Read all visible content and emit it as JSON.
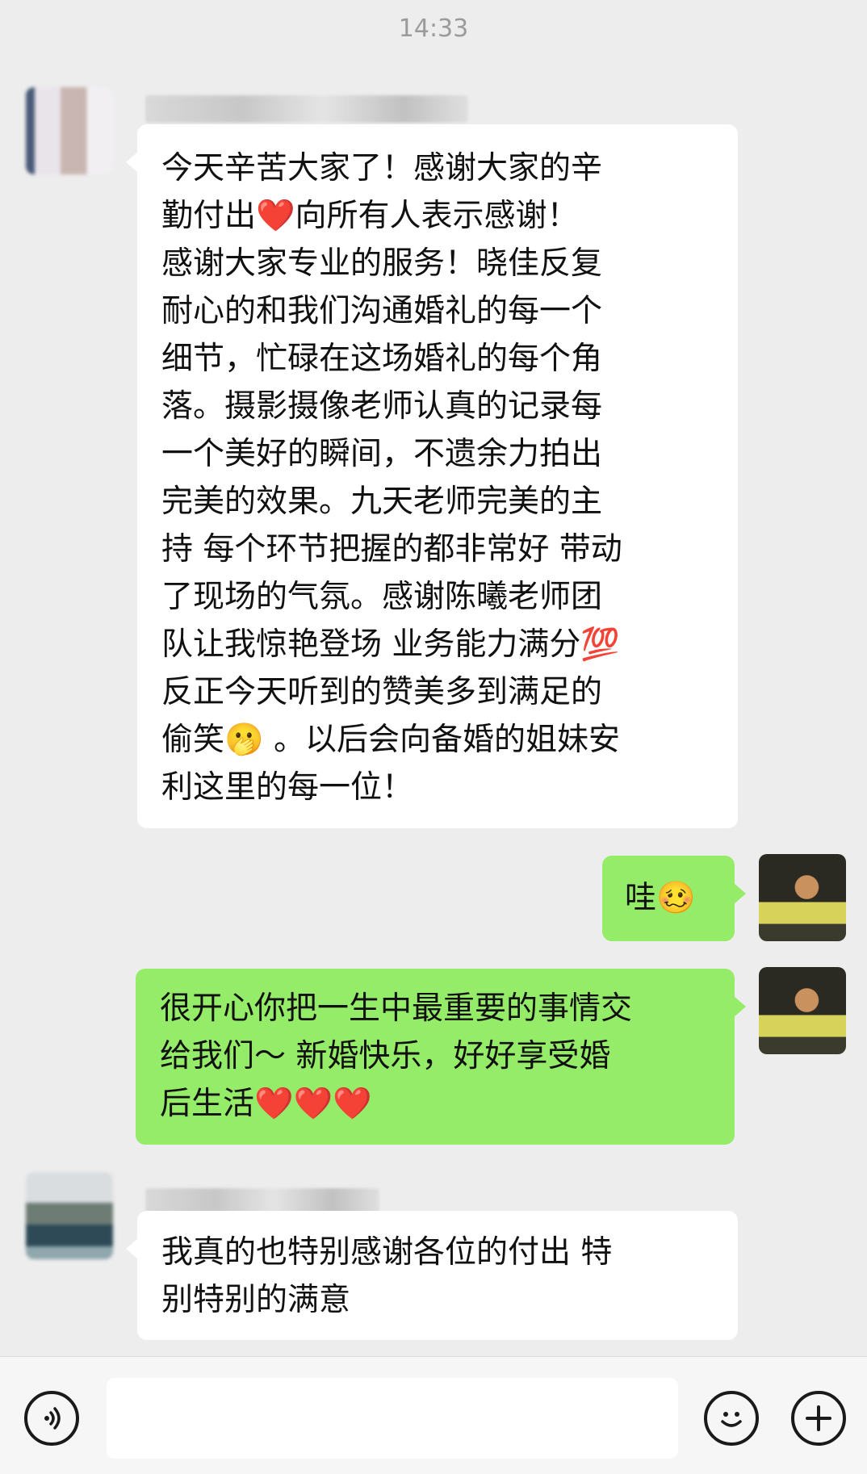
{
  "status": {
    "time": "14:33"
  },
  "messages": [
    {
      "direction": "incoming",
      "text": "今天辛苦大家了！感谢大家的辛\n勤付出❤️向所有人表示感谢！\n感谢大家专业的服务！晓佳反复\n耐心的和我们沟通婚礼的每一个\n细节，忙碌在这场婚礼的每个角\n落。摄影摄像老师认真的记录每\n一个美好的瞬间，不遗余力拍出\n完美的效果。九天老师完美的主\n持 每个环节把握的都非常好 带动\n了现场的气氛。感谢陈曦老师团\n队让我惊艳登场 业务能力满分💯\n反正今天听到的赞美多到满足的\n偷笑🫢 。以后会向备婚的姐妹安\n利这里的每一位！"
    },
    {
      "direction": "outgoing",
      "text": "哇🥴"
    },
    {
      "direction": "outgoing",
      "text": "很开心你把一生中最重要的事情交\n给我们～ 新婚快乐，好好享受婚\n后生活❤️❤️❤️"
    },
    {
      "direction": "incoming",
      "text": "我真的也特别感谢各位的付出 特\n别特别的满意"
    }
  ],
  "colors": {
    "background": "#ededed",
    "incoming_bubble": "#ffffff",
    "outgoing_bubble": "#95ec69"
  },
  "input_bar": {
    "voice_icon": "voice-icon",
    "emoji_icon": "emoji-icon",
    "plus_icon": "plus-icon"
  }
}
